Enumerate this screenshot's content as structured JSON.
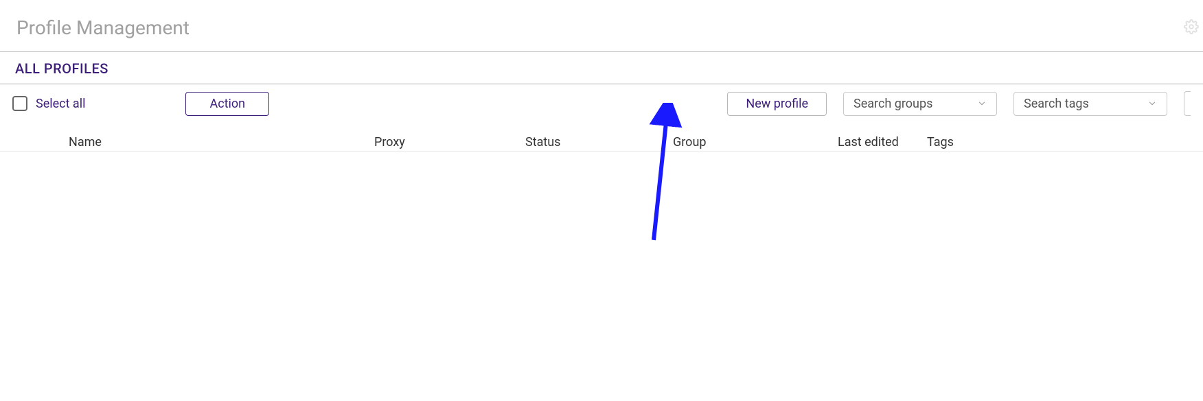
{
  "header": {
    "page_title": "Profile Management",
    "section_title": "ALL PROFILES"
  },
  "toolbar": {
    "select_all_label": "Select all",
    "action_label": "Action",
    "new_profile_label": "New profile",
    "search_groups_placeholder": "Search groups",
    "search_tags_placeholder": "Search tags"
  },
  "table": {
    "columns": {
      "name": "Name",
      "proxy": "Proxy",
      "status": "Status",
      "group": "Group",
      "last_edited": "Last edited",
      "tags": "Tags"
    },
    "rows": []
  },
  "colors": {
    "accent": "#3d1e78",
    "muted_title": "#a0a0a0",
    "annotation_arrow": "#1a1aff"
  }
}
